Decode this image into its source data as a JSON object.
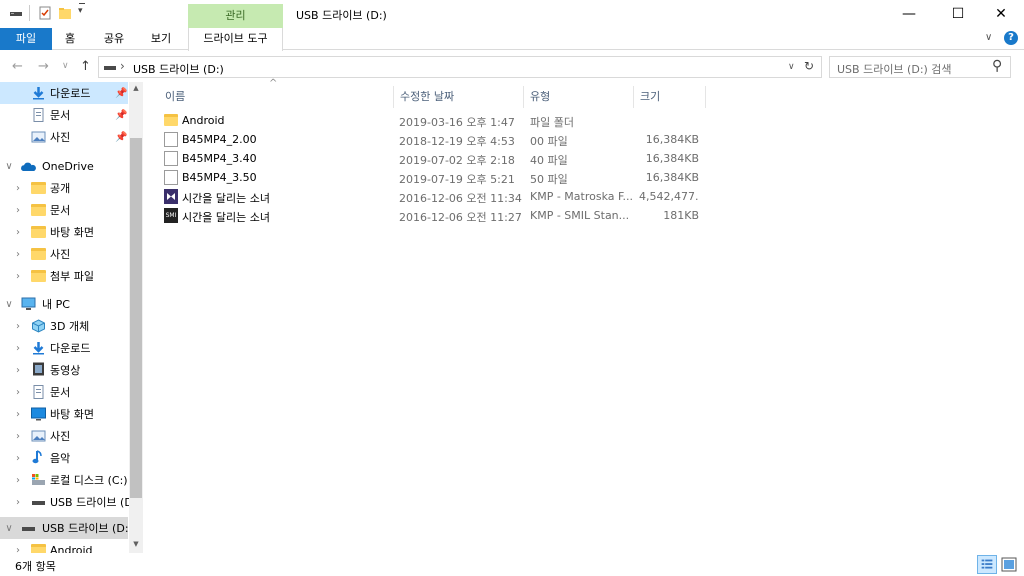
{
  "window": {
    "title": "USB 드라이브 (D:)",
    "context_tab": "관리",
    "controls": {
      "minimize": "—",
      "maximize": "☐",
      "close": "✕"
    }
  },
  "ribbon": {
    "tabs": [
      "파일",
      "홈",
      "공유",
      "보기",
      "드라이브 도구"
    ],
    "collapse": "∨",
    "help": "?"
  },
  "address": {
    "back": "←",
    "forward": "→",
    "recent": "∨",
    "up": "↑",
    "chevron": "›",
    "path": "USB 드라이브 (D:)",
    "dropdown": "∨",
    "refresh": "↻",
    "search_placeholder": "USB 드라이브 (D:) 검색",
    "search_icon": "⚲"
  },
  "nav": {
    "pinned": [
      {
        "label": "다운로드",
        "icon": "download-icon",
        "pin": "📌"
      },
      {
        "label": "문서",
        "icon": "document-icon",
        "pin": "📌"
      },
      {
        "label": "사진",
        "icon": "pictures-icon",
        "pin": "📌"
      }
    ],
    "onedrive": {
      "label": "OneDrive",
      "chevron": "∨"
    },
    "onedrive_items": [
      "공개",
      "문서",
      "바탕 화면",
      "사진",
      "첨부 파일"
    ],
    "thispc": {
      "label": "내 PC",
      "chevron": "∨"
    },
    "thispc_items": [
      {
        "label": "3D 개체",
        "icon": "3d-objects-icon"
      },
      {
        "label": "다운로드",
        "icon": "download-icon"
      },
      {
        "label": "동영상",
        "icon": "videos-icon"
      },
      {
        "label": "문서",
        "icon": "document-icon"
      },
      {
        "label": "바탕 화면",
        "icon": "desktop-icon"
      },
      {
        "label": "사진",
        "icon": "pictures-icon"
      },
      {
        "label": "음악",
        "icon": "music-icon"
      },
      {
        "label": "로컬 디스크 (C:)",
        "icon": "local-disk-icon"
      },
      {
        "label": "USB 드라이브 (D:)",
        "icon": "usb-drive-icon"
      }
    ],
    "usb_root": {
      "label": "USB 드라이브 (D:)",
      "chevron": "∨"
    },
    "usb_children": [
      "Android"
    ],
    "expand_glyph": "›"
  },
  "columns": [
    "이름",
    "수정한 날짜",
    "유형",
    "크기"
  ],
  "sort_indicator": "^",
  "files": [
    {
      "name": "Android",
      "date": "2019-03-16 오후 1:47",
      "type": "파일 폴더",
      "size": "",
      "icon": "folder-icon"
    },
    {
      "name": "B45MP4_2.00",
      "date": "2018-12-19 오후 4:53",
      "type": "00 파일",
      "size": "16,384KB",
      "icon": "file-icon"
    },
    {
      "name": "B45MP4_3.40",
      "date": "2019-07-02 오후 2:18",
      "type": "40 파일",
      "size": "16,384KB",
      "icon": "file-icon"
    },
    {
      "name": "B45MP4_3.50",
      "date": "2019-07-19 오후 5:21",
      "type": "50 파일",
      "size": "16,384KB",
      "icon": "file-icon"
    },
    {
      "name": "시간을 달리는 소녀",
      "date": "2016-12-06 오전 11:34",
      "type": "KMP - Matroska F...",
      "size": "4,542,477...",
      "icon": "mkv-video-icon"
    },
    {
      "name": "시간을 달리는 소녀",
      "date": "2016-12-06 오전 11:27",
      "type": "KMP - SMIL Stan...",
      "size": "181KB",
      "icon": "smi-subtitle-icon"
    }
  ],
  "smi_icon_text": "SMI",
  "status": {
    "count": "6개 항목"
  },
  "colors": {
    "file_tab": "#1979ca",
    "context_tab": "#c6eab1",
    "selection": "#cce8ff",
    "folder": "#ffd86a"
  }
}
